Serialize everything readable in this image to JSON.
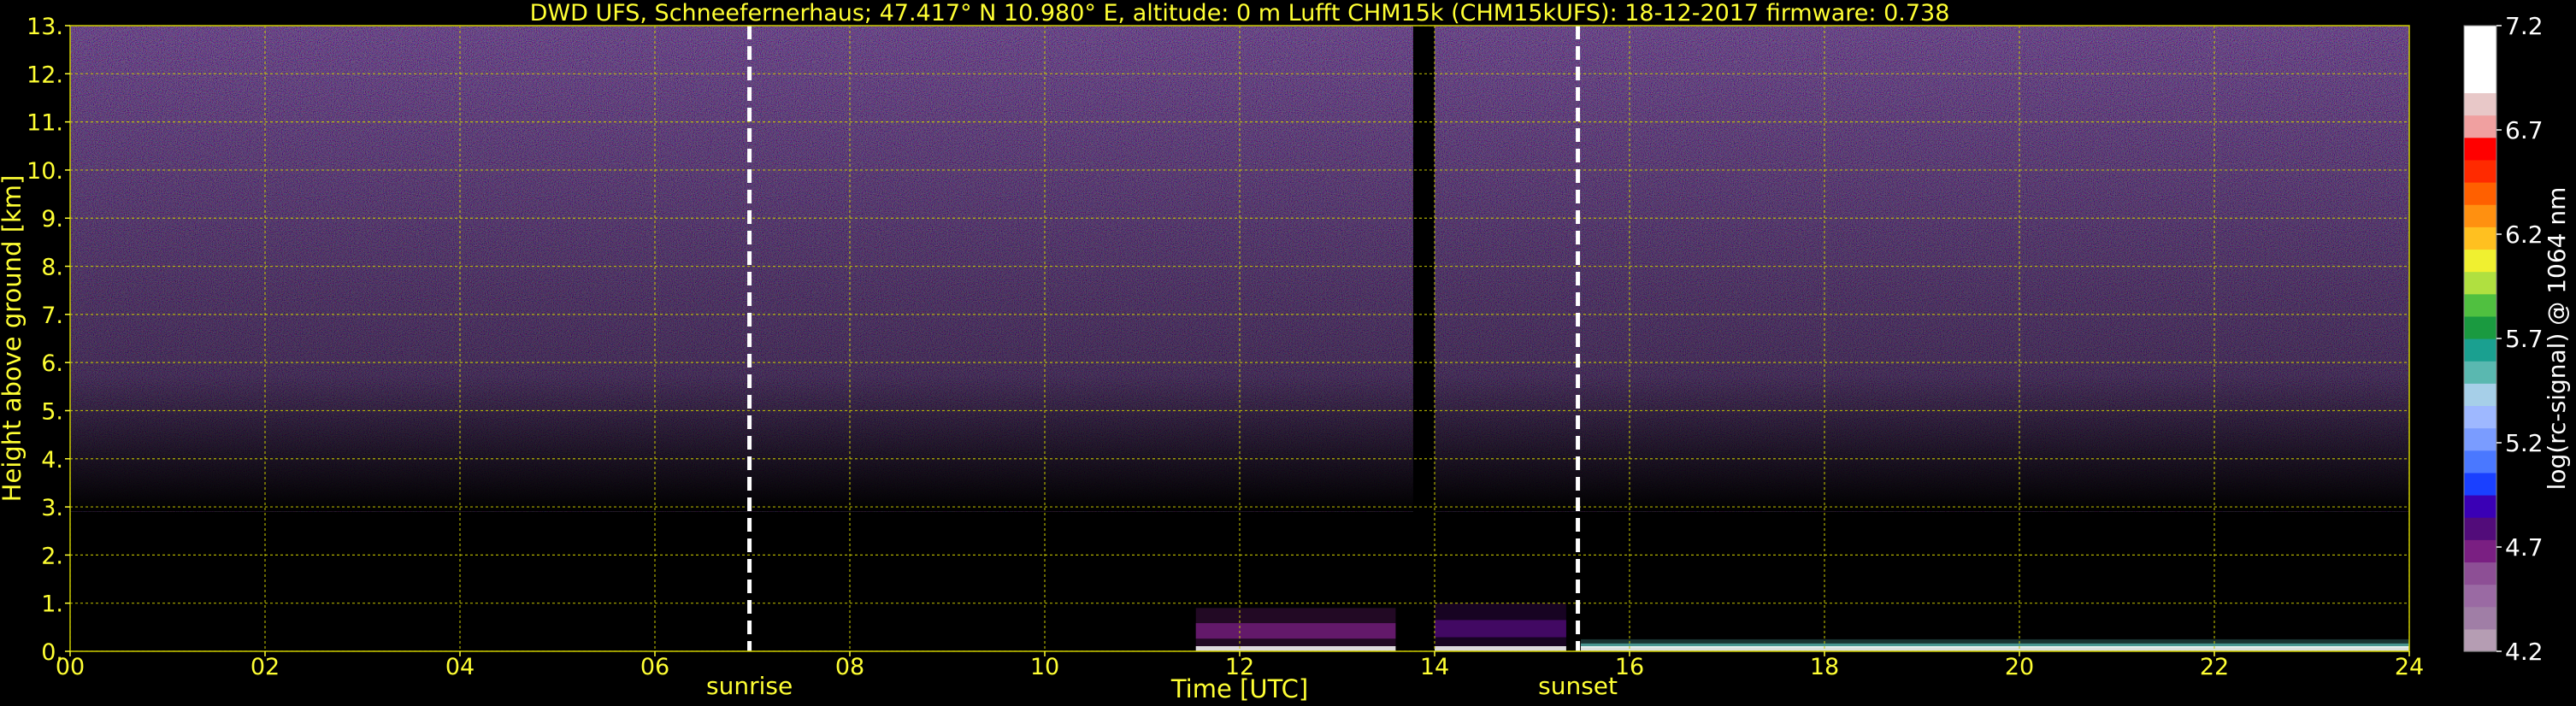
{
  "chart_data": {
    "type": "heatmap",
    "title": "DWD UFS, Schneefernerhaus; 47.417° N 10.980° E, altitude: 0 m    Lufft CHM15k (CHM15kUFS): 18-12-2017    firmware: 0.738",
    "xlabel": "Time [UTC]",
    "ylabel": "Height above ground [km]",
    "x_range": [
      0,
      24
    ],
    "y_range": [
      0,
      13
    ],
    "x_ticks": [
      "00",
      "02",
      "04",
      "06",
      "08",
      "10",
      "12",
      "14",
      "16",
      "18",
      "20",
      "22",
      "24"
    ],
    "y_ticks": [
      "0.",
      "1.",
      "2.",
      "3.",
      "4.",
      "5.",
      "6.",
      "7.",
      "8.",
      "9.",
      "10.",
      "11.",
      "12.",
      "13."
    ],
    "grid": true,
    "colorbar": {
      "label": "log(rc-signal) @ 1064 nm",
      "range": [
        4.2,
        7.2
      ],
      "ticks": [
        "4.2",
        "4.7",
        "5.2",
        "5.7",
        "6.2",
        "6.7",
        "7.2"
      ],
      "colors": [
        "#b59db3",
        "#a07ea6",
        "#9a6aa3",
        "#8d4f95",
        "#7a1f82",
        "#520c7a",
        "#3a00b5",
        "#1a40ff",
        "#4a78ff",
        "#7a9cff",
        "#9eb8ff",
        "#a6cfe8",
        "#5ab8b0",
        "#1aa090",
        "#1a9a40",
        "#50c040",
        "#b0e040",
        "#f0f030",
        "#ffc020",
        "#ff9010",
        "#ff6000",
        "#ff2a00",
        "#ff0000",
        "#f0a0a0",
        "#e8c8c8",
        "#ffffff",
        "#ffffff",
        "#ffffff"
      ]
    },
    "markers": [
      {
        "label": "sunrise",
        "x": 6.97
      },
      {
        "label": "sunset",
        "x": 15.47
      }
    ],
    "no_data_periods": [
      [
        13.78,
        14.0
      ]
    ],
    "noise_floor_km": 2.9,
    "signal_features": [
      {
        "x_start": 11.55,
        "x_end": 13.6,
        "y_top_km": 0.9,
        "level": 4.7
      },
      {
        "x_start": 14.0,
        "x_end": 15.35,
        "y_top_km": 1.0,
        "level": 4.75
      },
      {
        "x_start": 15.5,
        "x_end": 24.0,
        "y_top_km": 0.25,
        "level": 5.5
      }
    ]
  },
  "colors": {
    "background": "#000000",
    "text": "#ffff33",
    "grid": "#cccc00",
    "markers": "#ffffff",
    "noise_tint": "#6a4cc0"
  }
}
